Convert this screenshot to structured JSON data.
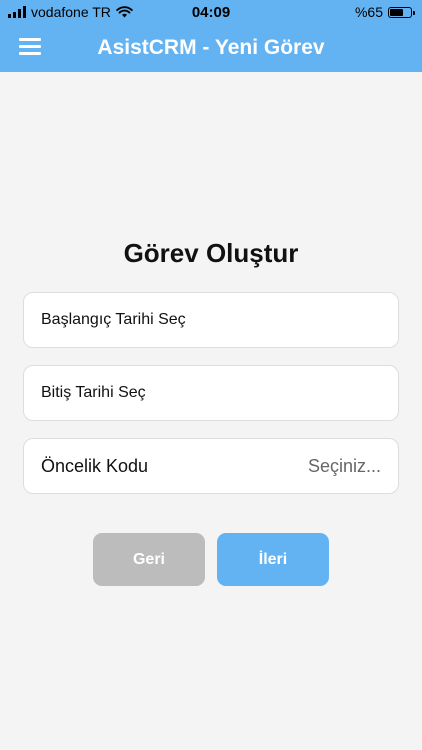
{
  "status_bar": {
    "carrier": "vodafone TR",
    "time": "04:09",
    "battery": "%65",
    "battery_level": 0.65
  },
  "navbar": {
    "title": "AsistCRM - Yeni Görev",
    "menu_icon": "hamburger-icon"
  },
  "form": {
    "title": "Görev Oluştur",
    "start_date_label": "Başlangıç Tarihi Seç",
    "end_date_label": "Bitiş Tarihi Seç",
    "priority_label": "Öncelik Kodu",
    "priority_value": "Seçiniz..."
  },
  "buttons": {
    "back_label": "Geri",
    "next_label": "İleri"
  },
  "colors": {
    "accent": "#63b3f3",
    "disabled": "#bcbcbc",
    "background": "#f4f4f4"
  }
}
